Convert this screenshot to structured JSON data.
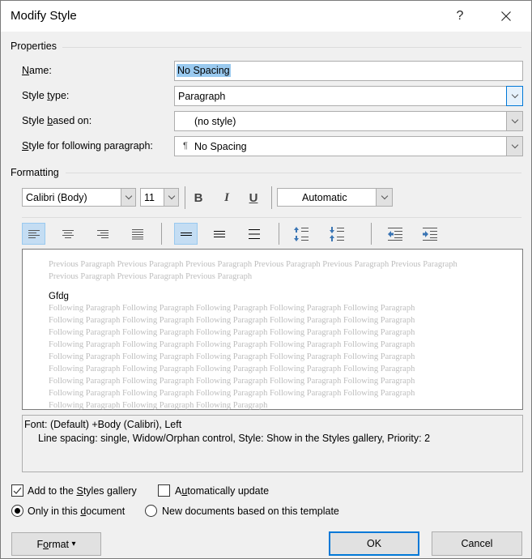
{
  "window": {
    "title": "Modify Style",
    "help_label": "?",
    "close_label": "✕"
  },
  "properties": {
    "section_label": "Properties",
    "name": {
      "label_u": "N",
      "label_rest": "ame:",
      "value": "No Spacing"
    },
    "style_type": {
      "label_pre": "Style ",
      "label_u": "t",
      "label_rest": "ype:",
      "value": "Paragraph"
    },
    "based_on": {
      "label_pre": "Style ",
      "label_u": "b",
      "label_rest": "ased on:",
      "value": "(no style)"
    },
    "following": {
      "label_u": "S",
      "label_rest": "tyle for following paragraph:",
      "pilcrow": "¶",
      "value": "No Spacing"
    }
  },
  "formatting": {
    "section_label": "Formatting",
    "font": "Calibri (Body)",
    "size": "11",
    "bold": "B",
    "italic": "I",
    "underline": "U",
    "color": "Automatic",
    "alignment_buttons": [
      "align-left",
      "align-center",
      "align-right",
      "justify"
    ],
    "alignment_active": "align-left",
    "spacing_buttons": [
      "single-spacing",
      "one-half-spacing",
      "double-spacing"
    ],
    "spacing_active": "single-spacing",
    "paragraph_buttons": [
      "increase-paragraph-spacing",
      "decrease-paragraph-spacing"
    ],
    "indent_buttons": [
      "decrease-indent",
      "increase-indent"
    ]
  },
  "preview": {
    "previous": "Previous Paragraph Previous Paragraph Previous Paragraph Previous Paragraph Previous Paragraph Previous Paragraph Previous Paragraph Previous Paragraph Previous Paragraph",
    "sample": "Gfdg",
    "following": [
      "Following Paragraph Following Paragraph Following Paragraph Following Paragraph Following Paragraph",
      "Following Paragraph Following Paragraph Following Paragraph Following Paragraph Following Paragraph",
      "Following Paragraph Following Paragraph Following Paragraph Following Paragraph Following Paragraph",
      "Following Paragraph Following Paragraph Following Paragraph Following Paragraph Following Paragraph",
      "Following Paragraph Following Paragraph Following Paragraph Following Paragraph Following Paragraph",
      "Following Paragraph Following Paragraph Following Paragraph Following Paragraph Following Paragraph",
      "Following Paragraph Following Paragraph Following Paragraph Following Paragraph Following Paragraph",
      "Following Paragraph Following Paragraph Following Paragraph Following Paragraph Following Paragraph",
      "Following Paragraph Following Paragraph Following Paragraph"
    ]
  },
  "description": {
    "line1": "Font: (Default) +Body (Calibri), Left",
    "line2": "Line spacing:  single, Widow/Orphan control, Style: Show in the Styles gallery, Priority: 2"
  },
  "options": {
    "add_to_gallery": {
      "pre": "Add to the ",
      "u": "S",
      "rest": "tyles gallery",
      "checked": true
    },
    "auto_update": {
      "pre": "A",
      "u": "u",
      "rest": "tomatically update",
      "checked": false
    },
    "only_this_doc": {
      "pre": "Only in this ",
      "u": "d",
      "rest": "ocument",
      "selected": true
    },
    "new_docs": {
      "label": "New documents based on this template",
      "selected": false
    }
  },
  "buttons": {
    "format_pre": "F",
    "format_u": "o",
    "format_rest": "rmat",
    "format_caret": "▾",
    "ok": "OK",
    "cancel": "Cancel"
  }
}
